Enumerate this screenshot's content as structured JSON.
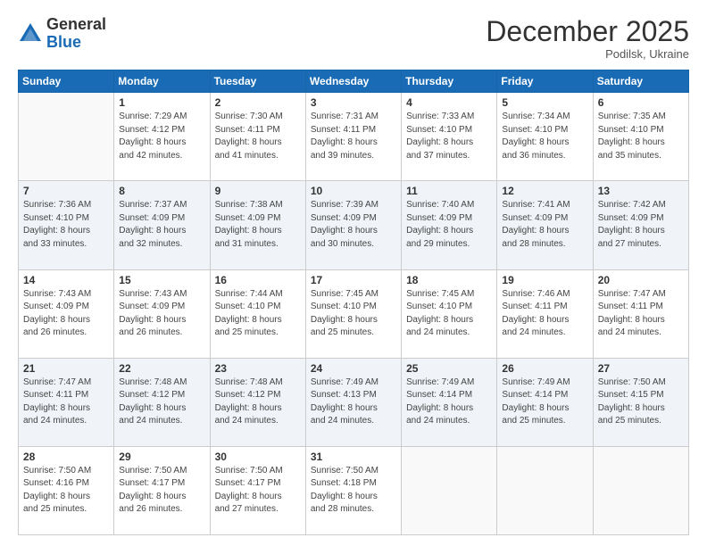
{
  "header": {
    "logo_general": "General",
    "logo_blue": "Blue",
    "month_title": "December 2025",
    "subtitle": "Podilsk, Ukraine"
  },
  "days_of_week": [
    "Sunday",
    "Monday",
    "Tuesday",
    "Wednesday",
    "Thursday",
    "Friday",
    "Saturday"
  ],
  "weeks": [
    {
      "shaded": false,
      "days": [
        {
          "num": "",
          "info": ""
        },
        {
          "num": "1",
          "info": "Sunrise: 7:29 AM\nSunset: 4:12 PM\nDaylight: 8 hours\nand 42 minutes."
        },
        {
          "num": "2",
          "info": "Sunrise: 7:30 AM\nSunset: 4:11 PM\nDaylight: 8 hours\nand 41 minutes."
        },
        {
          "num": "3",
          "info": "Sunrise: 7:31 AM\nSunset: 4:11 PM\nDaylight: 8 hours\nand 39 minutes."
        },
        {
          "num": "4",
          "info": "Sunrise: 7:33 AM\nSunset: 4:10 PM\nDaylight: 8 hours\nand 37 minutes."
        },
        {
          "num": "5",
          "info": "Sunrise: 7:34 AM\nSunset: 4:10 PM\nDaylight: 8 hours\nand 36 minutes."
        },
        {
          "num": "6",
          "info": "Sunrise: 7:35 AM\nSunset: 4:10 PM\nDaylight: 8 hours\nand 35 minutes."
        }
      ]
    },
    {
      "shaded": true,
      "days": [
        {
          "num": "7",
          "info": "Sunrise: 7:36 AM\nSunset: 4:10 PM\nDaylight: 8 hours\nand 33 minutes."
        },
        {
          "num": "8",
          "info": "Sunrise: 7:37 AM\nSunset: 4:09 PM\nDaylight: 8 hours\nand 32 minutes."
        },
        {
          "num": "9",
          "info": "Sunrise: 7:38 AM\nSunset: 4:09 PM\nDaylight: 8 hours\nand 31 minutes."
        },
        {
          "num": "10",
          "info": "Sunrise: 7:39 AM\nSunset: 4:09 PM\nDaylight: 8 hours\nand 30 minutes."
        },
        {
          "num": "11",
          "info": "Sunrise: 7:40 AM\nSunset: 4:09 PM\nDaylight: 8 hours\nand 29 minutes."
        },
        {
          "num": "12",
          "info": "Sunrise: 7:41 AM\nSunset: 4:09 PM\nDaylight: 8 hours\nand 28 minutes."
        },
        {
          "num": "13",
          "info": "Sunrise: 7:42 AM\nSunset: 4:09 PM\nDaylight: 8 hours\nand 27 minutes."
        }
      ]
    },
    {
      "shaded": false,
      "days": [
        {
          "num": "14",
          "info": "Sunrise: 7:43 AM\nSunset: 4:09 PM\nDaylight: 8 hours\nand 26 minutes."
        },
        {
          "num": "15",
          "info": "Sunrise: 7:43 AM\nSunset: 4:09 PM\nDaylight: 8 hours\nand 26 minutes."
        },
        {
          "num": "16",
          "info": "Sunrise: 7:44 AM\nSunset: 4:10 PM\nDaylight: 8 hours\nand 25 minutes."
        },
        {
          "num": "17",
          "info": "Sunrise: 7:45 AM\nSunset: 4:10 PM\nDaylight: 8 hours\nand 25 minutes."
        },
        {
          "num": "18",
          "info": "Sunrise: 7:45 AM\nSunset: 4:10 PM\nDaylight: 8 hours\nand 24 minutes."
        },
        {
          "num": "19",
          "info": "Sunrise: 7:46 AM\nSunset: 4:11 PM\nDaylight: 8 hours\nand 24 minutes."
        },
        {
          "num": "20",
          "info": "Sunrise: 7:47 AM\nSunset: 4:11 PM\nDaylight: 8 hours\nand 24 minutes."
        }
      ]
    },
    {
      "shaded": true,
      "days": [
        {
          "num": "21",
          "info": "Sunrise: 7:47 AM\nSunset: 4:11 PM\nDaylight: 8 hours\nand 24 minutes."
        },
        {
          "num": "22",
          "info": "Sunrise: 7:48 AM\nSunset: 4:12 PM\nDaylight: 8 hours\nand 24 minutes."
        },
        {
          "num": "23",
          "info": "Sunrise: 7:48 AM\nSunset: 4:12 PM\nDaylight: 8 hours\nand 24 minutes."
        },
        {
          "num": "24",
          "info": "Sunrise: 7:49 AM\nSunset: 4:13 PM\nDaylight: 8 hours\nand 24 minutes."
        },
        {
          "num": "25",
          "info": "Sunrise: 7:49 AM\nSunset: 4:14 PM\nDaylight: 8 hours\nand 24 minutes."
        },
        {
          "num": "26",
          "info": "Sunrise: 7:49 AM\nSunset: 4:14 PM\nDaylight: 8 hours\nand 25 minutes."
        },
        {
          "num": "27",
          "info": "Sunrise: 7:50 AM\nSunset: 4:15 PM\nDaylight: 8 hours\nand 25 minutes."
        }
      ]
    },
    {
      "shaded": false,
      "days": [
        {
          "num": "28",
          "info": "Sunrise: 7:50 AM\nSunset: 4:16 PM\nDaylight: 8 hours\nand 25 minutes."
        },
        {
          "num": "29",
          "info": "Sunrise: 7:50 AM\nSunset: 4:17 PM\nDaylight: 8 hours\nand 26 minutes."
        },
        {
          "num": "30",
          "info": "Sunrise: 7:50 AM\nSunset: 4:17 PM\nDaylight: 8 hours\nand 27 minutes."
        },
        {
          "num": "31",
          "info": "Sunrise: 7:50 AM\nSunset: 4:18 PM\nDaylight: 8 hours\nand 28 minutes."
        },
        {
          "num": "",
          "info": ""
        },
        {
          "num": "",
          "info": ""
        },
        {
          "num": "",
          "info": ""
        }
      ]
    }
  ]
}
